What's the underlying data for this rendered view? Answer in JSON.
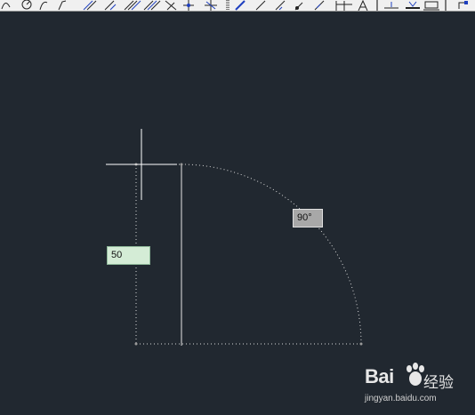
{
  "toolbar": {
    "icons": [
      "arc-icon",
      "circle-icon",
      "curve-icon",
      "polyline-icon",
      "line-icon",
      "line-icon",
      "hatch-icon",
      "hatch-icon",
      "xline-icon",
      "crosshair-icon",
      "dim-icon",
      "dim-icon",
      "dim-icon",
      "dim-icon",
      "text-style-icon",
      "text-icon",
      "dim-style-icon",
      "dim-style-icon",
      "dim-style-icon",
      "snap-icon"
    ]
  },
  "drawing": {
    "length_input": "50",
    "angle_input": "90°"
  },
  "watermark": {
    "brand_left": "Bai",
    "brand_right": "经验",
    "url": "jingyan.baidu.com"
  },
  "colors": {
    "canvas": "#212830",
    "geometry": "#e6e6e6",
    "length_input_bg": "#d4ecd6",
    "angle_input_bg": "#a8a8a8"
  }
}
